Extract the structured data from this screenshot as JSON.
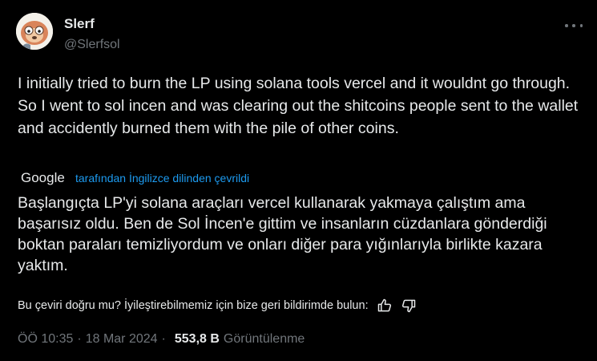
{
  "author": {
    "display_name": "Slerf",
    "handle": "@Slerfsol"
  },
  "tweet": {
    "text": "I initially tried to burn the LP using solana tools vercel and it wouldnt go through. So I went to sol incen and was clearing out the shitcoins people sent to the wallet and accidently burned them with the pile of other coins.",
    "translated_text": "Başlangıçta LP'yi solana araçları vercel kullanarak yakmaya çalıştım ama başarısız oldu. Ben de Sol İncen'e gittim ve insanların cüzdanlara gönderdiği boktan paraları temizliyordum ve onları diğer para yığınlarıyla birlikte kazara yaktım."
  },
  "translation": {
    "provider": "Google",
    "label": "tarafından İngilizce dilinden çevrildi",
    "feedback_prompt": "Bu çeviri doğru mu? İyileştirebilmemiz için bize geri bildirimde bulun:"
  },
  "meta": {
    "time": "ÖÖ 10:35",
    "separator": "·",
    "date": "18 Mar 2024",
    "views_count": "553,8 B",
    "views_label": "Görüntülenme"
  },
  "icons": {
    "more": "more-horizontal-icon",
    "thumbs_up": "thumbs-up-icon",
    "thumbs_down": "thumbs-down-icon"
  },
  "colors": {
    "background": "#000000",
    "text": "#e7e9ea",
    "secondary": "#71767b",
    "link": "#1d9bf0"
  }
}
